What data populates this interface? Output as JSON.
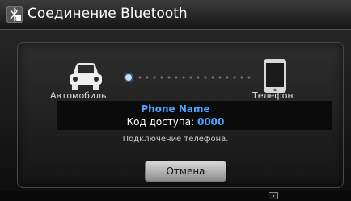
{
  "header": {
    "title": "Соединение Bluetooth",
    "icon": "bluetooth-phone-icon"
  },
  "dialog": {
    "car_label": "Автомобиль",
    "phone_label": "Телефон",
    "car_icon": "car-icon",
    "phone_icon": "smartphone-icon",
    "device_name": "Phone Name",
    "passkey_label": "Код доступа:",
    "passkey_value": "0000",
    "status": "Подключение телефона.",
    "cancel_label": "Отмена"
  },
  "colors": {
    "accent": "#4da3ff",
    "text": "#ffffff"
  }
}
